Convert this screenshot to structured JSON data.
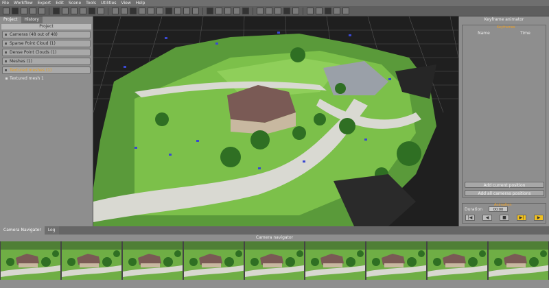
{
  "menu": [
    "File",
    "Workflow",
    "Export",
    "Edit",
    "Scene",
    "Tools",
    "Utilities",
    "View",
    "Help"
  ],
  "toolbar": {
    "icons": [
      "new-icon",
      "open-icon",
      "save-icon",
      "stop-icon",
      "camera-icon",
      "rotate-icon",
      "orbit-icon",
      "zoom-fit-icon",
      "light-icon",
      "camera-view-icon",
      "frame-icon",
      "pen-icon",
      "brush-icon",
      "scale-icon",
      "cut-icon",
      "fill-icon",
      "checker-icon",
      "grid-icon",
      "wire-icon",
      "point-icon",
      "texture-icon",
      "mesh-icon",
      "export-icon",
      "screenshot-icon",
      "focus-icon",
      "sphere-icon",
      "box-icon",
      "wire-box-icon",
      "render-icon",
      "cube-icon",
      "measure-icon",
      "axis-icon",
      "color-icon",
      "graph-icon",
      "info-icon",
      "vr-icon"
    ]
  },
  "left_panel": {
    "tabs": [
      "Project",
      "History"
    ],
    "header": "Project",
    "items": [
      {
        "label": "Cameras (48 out of 48)",
        "highlight": false
      },
      {
        "label": "Sparse Point Cloud (1)",
        "highlight": false
      },
      {
        "label": "Dense Point Clouds (1)",
        "highlight": false
      },
      {
        "label": "Meshes (1)",
        "highlight": false
      },
      {
        "label": "Textured meshes (1)",
        "highlight": true
      }
    ],
    "sub_item": "Textured mesh 1"
  },
  "right_panel": {
    "title": "Keyframe animator",
    "keyframes_label": "Keyframes",
    "col_name": "Name",
    "col_time": "Time",
    "btn_add_current": "Add current position",
    "btn_add_all": "Add all cameras positions",
    "animation_label": "Animation",
    "duration_label": "Duration",
    "duration_value": "00:00",
    "play_buttons": [
      "|◀",
      "◀",
      "■",
      "▶|",
      "▶"
    ]
  },
  "bottom": {
    "tabs": [
      "Camera Navigator",
      "Log"
    ],
    "navigator_title": "Camera navigator",
    "thumb_count": 9
  }
}
